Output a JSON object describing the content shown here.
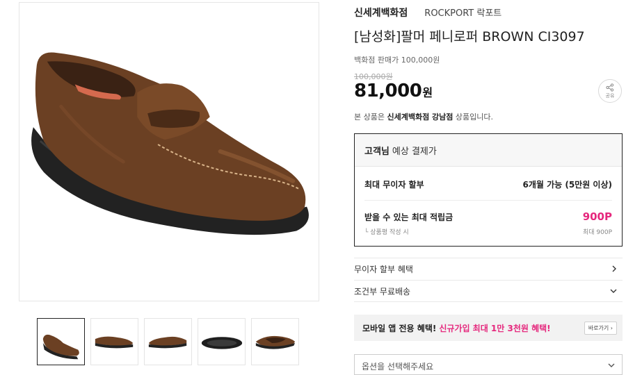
{
  "product": {
    "store_name": "신세계백화점",
    "brand": "ROCKPORT 락포트",
    "title": "[남성화]팔머 페니로퍼 BROWN CI3097",
    "dept_price_label": "백화점 판매가 100,000원",
    "original_price": "100,000원",
    "sale_price": "81,000",
    "sale_unit": "원",
    "share_label": "공유",
    "notice_prefix": "본 상품은 ",
    "notice_store": "신세계백화점 강남점",
    "notice_suffix": " 상품입니다."
  },
  "payment": {
    "head_bold": "고객님",
    "head_rest": "예상 결제가",
    "installment_label": "최대 무이자 할부",
    "installment_value": "6개월 가능 (5만원 이상)",
    "points_label": "받을 수 있는 최대 적립금",
    "points_value": "900P",
    "points_sub_label": "└ 상품평 작성 시",
    "points_sub_value": "최대 900P"
  },
  "accordion": {
    "interest_free": "무이자 할부 혜택",
    "free_shipping": "조건부 무료배송"
  },
  "promo": {
    "bold": "모바일 앱 전용 혜택!",
    "highlight": "신규가입 최대 1만 3천원 혜택!",
    "button": "바로가기 ›"
  },
  "option_select": {
    "placeholder": "옵션을 선택해주세요"
  },
  "thumbnails": [
    {
      "name": "thumb-1"
    },
    {
      "name": "thumb-2"
    },
    {
      "name": "thumb-3"
    },
    {
      "name": "thumb-4"
    },
    {
      "name": "thumb-5"
    }
  ],
  "colors": {
    "accent_pink": "#e5287d",
    "shoe_brown": "#6b4023",
    "sole_dark": "#222222"
  }
}
